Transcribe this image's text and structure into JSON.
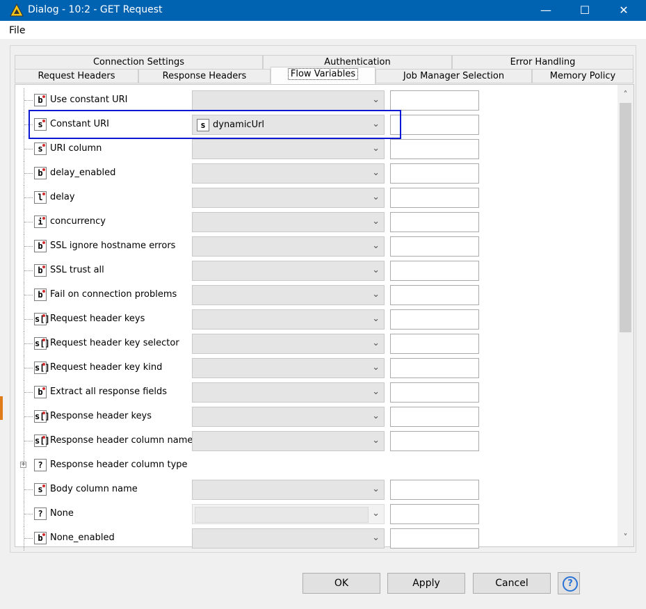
{
  "window": {
    "title": "Dialog - 10:2 - GET Request",
    "min_glyph": "—",
    "max_glyph": "☐",
    "close_glyph": "✕"
  },
  "menu": {
    "file": "File"
  },
  "tabs_row1": [
    "Connection Settings",
    "Authentication",
    "Error Handling"
  ],
  "tabs_row2": [
    "Request Headers",
    "Response Headers",
    "Flow Variables",
    "Job Manager Selection",
    "Memory Policy"
  ],
  "active_tab": "Flow Variables",
  "rows": [
    {
      "type": "b",
      "label": "Use constant URI",
      "value": ""
    },
    {
      "type": "s",
      "label": "Constant URI",
      "value": "dynamicUrl",
      "value_type": "s"
    },
    {
      "type": "s",
      "label": "URI column",
      "value": ""
    },
    {
      "type": "b",
      "label": "delay_enabled",
      "value": ""
    },
    {
      "type": "l",
      "label": "delay",
      "value": ""
    },
    {
      "type": "i",
      "label": "concurrency",
      "value": ""
    },
    {
      "type": "b",
      "label": "SSL ignore hostname errors",
      "value": ""
    },
    {
      "type": "b",
      "label": "SSL trust all",
      "value": ""
    },
    {
      "type": "b",
      "label": "Fail on connection problems",
      "value": ""
    },
    {
      "type": "s[]",
      "label": "Request header keys",
      "value": ""
    },
    {
      "type": "s[]",
      "label": "Request header key selector",
      "value": ""
    },
    {
      "type": "s[]",
      "label": "Request header key kind",
      "value": ""
    },
    {
      "type": "b",
      "label": "Extract all response fields",
      "value": ""
    },
    {
      "type": "s[]",
      "label": "Response header keys",
      "value": ""
    },
    {
      "type": "s[]",
      "label": "Response header column name",
      "value": ""
    },
    {
      "type": "?",
      "label": "Response header column type",
      "value": "",
      "expandable": true
    },
    {
      "type": "s",
      "label": "Body column name",
      "value": ""
    },
    {
      "type": "?",
      "label": "None",
      "value": "",
      "disabled": true
    },
    {
      "type": "b",
      "label": "None_enabled",
      "value": ""
    }
  ],
  "buttons": {
    "ok": "OK",
    "apply": "Apply",
    "cancel": "Cancel",
    "help": "?"
  },
  "colors": {
    "titlebar": "#0063b1",
    "highlight": "#0a18d6",
    "type_dot": "#d12a2a"
  }
}
